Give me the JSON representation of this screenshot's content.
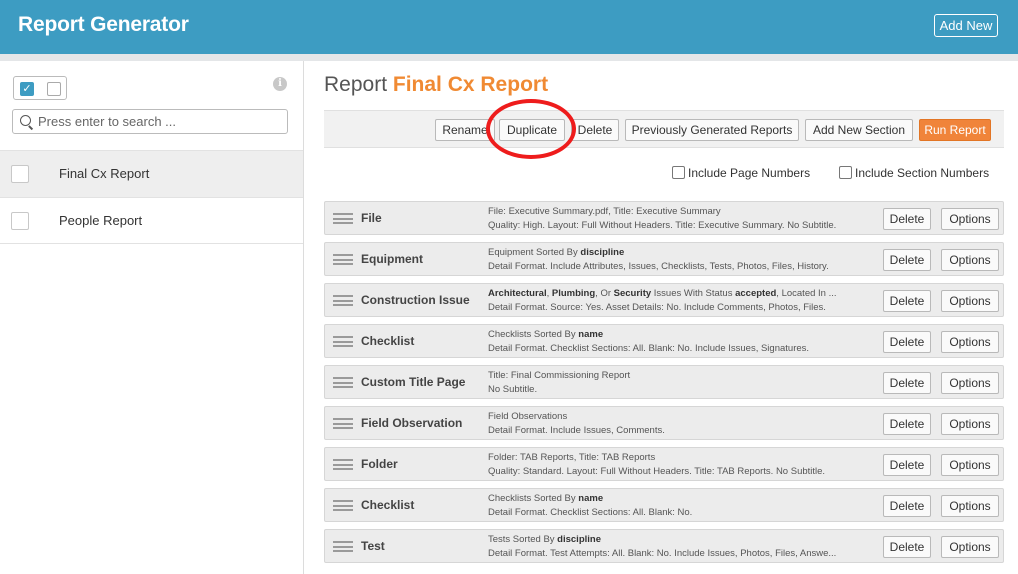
{
  "header": {
    "title": "Report Generator",
    "add_new_label": "Add New"
  },
  "sidebar": {
    "search_placeholder": "Press enter to search ...",
    "reports": [
      {
        "name": "Final Cx Report",
        "selected": true
      },
      {
        "name": "People Report",
        "selected": false
      }
    ]
  },
  "main": {
    "title_prefix": "Report",
    "title_name": "Final Cx Report",
    "toolbar": {
      "rename": "Rename",
      "duplicate": "Duplicate",
      "delete": "Delete",
      "previous": "Previously Generated Reports",
      "add_section": "Add New Section",
      "run": "Run Report"
    },
    "options": {
      "page_numbers": "Include Page Numbers",
      "section_numbers": "Include Section Numbers"
    },
    "delete_label": "Delete",
    "options_label": "Options",
    "sections": [
      {
        "name": "File",
        "line1": "File: Executive Summary.pdf, Title: Executive Summary",
        "line2": "Quality: High. Layout: Full Without Headers. Title: Executive Summary. No Subtitle."
      },
      {
        "name": "Equipment",
        "line1_pre": "Equipment Sorted By ",
        "line1_bold": "discipline",
        "line2": "Detail Format. Include Attributes, Issues, Checklists, Tests, Photos, Files, History."
      },
      {
        "name": "Construction Issue",
        "line1_b1": "Architectural",
        "line1_t1": ", ",
        "line1_b2": "Plumbing",
        "line1_t2": ", Or ",
        "line1_b3": "Security",
        "line1_t3": " Issues With Status ",
        "line1_b4": "accepted",
        "line1_t4": ", Located In ...",
        "line2": "Detail Format. Source: Yes. Asset Details: No. Include Comments, Photos, Files."
      },
      {
        "name": "Checklist",
        "line1_pre": "Checklists Sorted By ",
        "line1_bold": "name",
        "line2": "Detail Format. Checklist Sections: All. Blank: No. Include Issues, Signatures."
      },
      {
        "name": "Custom Title Page",
        "line1": "Title: Final Commissioning Report",
        "line2": "No Subtitle."
      },
      {
        "name": "Field Observation",
        "line1": "Field Observations",
        "line2": "Detail Format. Include Issues, Comments."
      },
      {
        "name": "Folder",
        "line1": "Folder: TAB Reports, Title: TAB Reports",
        "line2": "Quality: Standard. Layout: Full Without Headers. Title: TAB Reports. No Subtitle."
      },
      {
        "name": "Checklist",
        "line1_pre": "Checklists Sorted By ",
        "line1_bold": "name",
        "line2": "Detail Format. Checklist Sections: All. Blank: No."
      },
      {
        "name": "Test",
        "line1_pre": "Tests Sorted By ",
        "line1_bold": "discipline",
        "line2": "Detail Format. Test Attempts: All. Blank: No. Include Issues, Photos, Files, Answe..."
      }
    ]
  },
  "colors": {
    "header_bg": "#3d9cc2",
    "accent_orange": "#f08a33",
    "run_button": "#f0843a",
    "highlight_circle": "#ee1c1c"
  }
}
